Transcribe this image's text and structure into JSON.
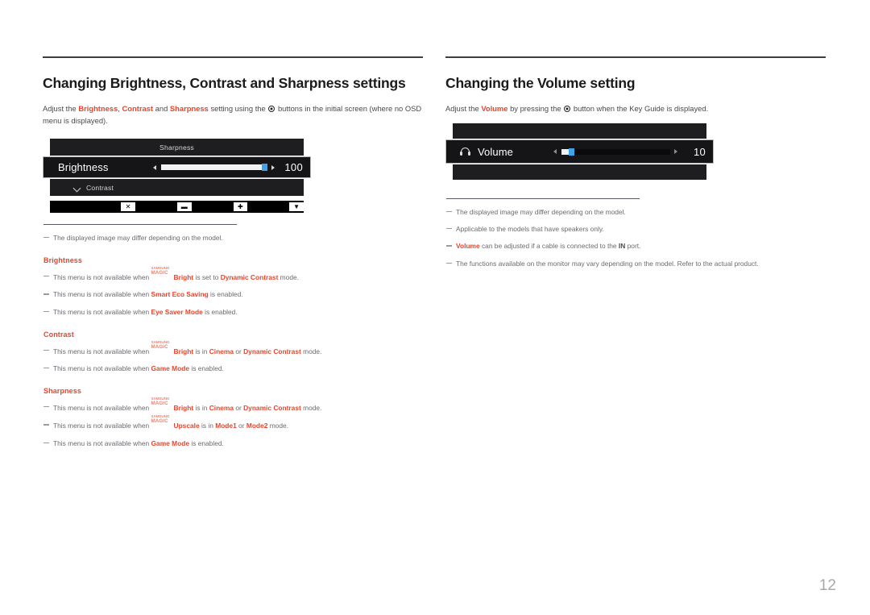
{
  "page": {
    "number": "12"
  },
  "left": {
    "title": "Changing Brightness, Contrast and Sharpness settings",
    "lead": {
      "p1": "Adjust the ",
      "b1": "Brightness",
      "sep1": ", ",
      "b2": "Contrast",
      "sep2": " and ",
      "b3": "Sharpness",
      "p2": " setting using the ",
      "icon": "jog-button-icon",
      "p3": " buttons in the initial screen (where no OSD menu is displayed)."
    },
    "osd": {
      "row_top_label": "Sharpness",
      "selected_label": "Brightness",
      "selected_value": "100",
      "fill_percent": 100,
      "row_bottom_label": "Contrast",
      "row_bottom_icon": "chevron-down-icon",
      "left_arrow": "◀",
      "right_arrow": "▶",
      "keyguide": [
        {
          "name": "close-key",
          "glyph": "✕"
        },
        {
          "name": "minus-key",
          "glyph": "▬"
        },
        {
          "name": "plus-key",
          "glyph": "✚"
        },
        {
          "name": "down-key",
          "glyph": "▼"
        }
      ]
    },
    "notes_top": [
      {
        "text": "The displayed image may differ depending on the model."
      }
    ],
    "groups": [
      {
        "heading": "Brightness",
        "notes": [
          {
            "pre": "This menu is not available when ",
            "magic": true,
            "magic_top": "SAMSUNG",
            "magic_bottom": "MAGIC",
            "term": "Bright",
            "mid": " is set to ",
            "value1": "Dynamic Contrast",
            "post": " mode."
          },
          {
            "pre": "This menu is not available when ",
            "magic": false,
            "term": "Smart Eco Saving",
            "mid": " is enabled.",
            "value1": "",
            "post": ""
          },
          {
            "pre": "This menu is not available when ",
            "magic": false,
            "term": "Eye Saver Mode",
            "mid": " is enabled.",
            "value1": "",
            "post": ""
          }
        ]
      },
      {
        "heading": "Contrast",
        "notes": [
          {
            "pre": "This menu is not available when ",
            "magic": true,
            "magic_top": "SAMSUNG",
            "magic_bottom": "MAGIC",
            "term": "Bright",
            "mid": " is in ",
            "value1": "Cinema",
            "conj": " or ",
            "value2": "Dynamic Contrast",
            "post": " mode."
          },
          {
            "pre": "This menu is not available when ",
            "magic": false,
            "term": "Game Mode",
            "mid": " is enabled.",
            "value1": "",
            "post": ""
          }
        ]
      },
      {
        "heading": "Sharpness",
        "notes": [
          {
            "pre": "This menu is not available when ",
            "magic": true,
            "magic_top": "SAMSUNG",
            "magic_bottom": "MAGIC",
            "term": "Bright",
            "mid": " is in ",
            "value1": "Cinema",
            "conj": " or ",
            "value2": "Dynamic Contrast",
            "post": " mode."
          },
          {
            "pre": "This menu is not available when ",
            "magic": true,
            "magic_top": "SAMSUNG",
            "magic_bottom": "MAGIC",
            "term": "Upscale",
            "mid": " is in ",
            "value1": "Mode1",
            "conj": " or ",
            "value2": "Mode2",
            "post": " mode."
          },
          {
            "pre": "This menu is not available when ",
            "magic": false,
            "term": "Game Mode",
            "mid": " is enabled.",
            "value1": "",
            "post": ""
          }
        ]
      }
    ]
  },
  "right": {
    "title": "Changing the Volume setting",
    "lead": {
      "p1": "Adjust the ",
      "b1": "Volume",
      "p2": " by pressing the ",
      "icon": "jog-button-icon",
      "p3": " button when the Key Guide is displayed."
    },
    "osd": {
      "selected_label": "Volume",
      "selected_value": "10",
      "fill_percent": 10,
      "icon": "headphone-icon",
      "left_arrow": "◀",
      "right_arrow": "▶"
    },
    "notes": [
      {
        "kind": "plain",
        "text": "The displayed image may differ depending on the model."
      },
      {
        "kind": "plain",
        "text": "Applicable to the models that have speakers only."
      },
      {
        "kind": "mixed",
        "red": "Volume",
        "mid": " can be adjusted if a cable is connected to the ",
        "bold": "IN",
        "post": " port."
      },
      {
        "kind": "plain",
        "text": "The functions available on the monitor may vary depending on the model. Refer to the actual product."
      }
    ]
  },
  "colors": {
    "accent": "#e8452b",
    "slider_thumb": "#3fa3e8",
    "osd_bg": "#1e1e20",
    "text": "#4a4a4a"
  }
}
